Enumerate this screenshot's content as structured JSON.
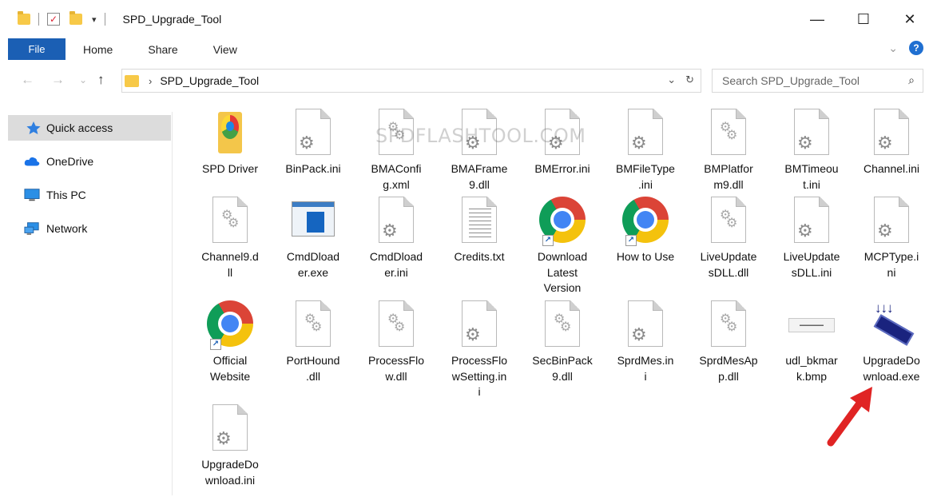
{
  "window": {
    "title": "SPD_Upgrade_Tool",
    "controls": {
      "minimize": "—",
      "maximize": "☐",
      "close": "✕"
    }
  },
  "ribbon": {
    "tabs": [
      "File",
      "Home",
      "Share",
      "View"
    ],
    "expand_glyph": "⌄",
    "help_glyph": "?"
  },
  "address": {
    "back": "←",
    "forward": "→",
    "recent": "⌄",
    "up": "↑",
    "breadcrumb_sep": "›",
    "path": "SPD_Upgrade_Tool",
    "dropdown": "⌄",
    "refresh": "↻",
    "search_placeholder": "Search SPD_Upgrade_Tool",
    "search_glyph": "⌕"
  },
  "sidebar": {
    "items": [
      {
        "label": "Quick access",
        "icon": "star-icon",
        "selected": true
      },
      {
        "label": "OneDrive",
        "icon": "cloud-icon",
        "selected": false
      },
      {
        "label": "This PC",
        "icon": "monitor-icon",
        "selected": false
      },
      {
        "label": "Network",
        "icon": "network-icon",
        "selected": false
      }
    ]
  },
  "watermark": "SPDFLASHTOOL.COM",
  "files": [
    {
      "name": "SPD Driver",
      "label_lines": [
        "SPD Driver"
      ],
      "type": "driver"
    },
    {
      "name": "BinPack.ini",
      "label_lines": [
        "BinPack.ini"
      ],
      "type": "ini"
    },
    {
      "name": "BMAConfig.xml",
      "label_lines": [
        "BMAConfi",
        "g.xml"
      ],
      "type": "dll"
    },
    {
      "name": "BMAFrame9.dll",
      "label_lines": [
        "BMAFrame",
        "9.dll"
      ],
      "type": "ini"
    },
    {
      "name": "BMError.ini",
      "label_lines": [
        "BMError.ini"
      ],
      "type": "ini"
    },
    {
      "name": "BMFileType.ini",
      "label_lines": [
        "BMFileType",
        ".ini"
      ],
      "type": "ini"
    },
    {
      "name": "BMPlatform9.dll",
      "label_lines": [
        "BMPlatfor",
        "m9.dll"
      ],
      "type": "dll"
    },
    {
      "name": "BMTimeout.ini",
      "label_lines": [
        "BMTimeou",
        "t.ini"
      ],
      "type": "ini"
    },
    {
      "name": "Channel.ini",
      "label_lines": [
        "Channel.ini"
      ],
      "type": "ini"
    },
    {
      "name": "Channel9.dll",
      "label_lines": [
        "Channel9.d",
        "ll"
      ],
      "type": "dll"
    },
    {
      "name": "CmdDloader.exe",
      "label_lines": [
        "CmdDload",
        "er.exe"
      ],
      "type": "exe"
    },
    {
      "name": "CmdDloader.ini",
      "label_lines": [
        "CmdDload",
        "er.ini"
      ],
      "type": "ini"
    },
    {
      "name": "Credits.txt",
      "label_lines": [
        "Credits.txt"
      ],
      "type": "txt"
    },
    {
      "name": "Download Latest Version",
      "label_lines": [
        "Download",
        "Latest",
        "Version"
      ],
      "type": "chrome"
    },
    {
      "name": "How to Use",
      "label_lines": [
        "How to Use"
      ],
      "type": "chrome"
    },
    {
      "name": "LiveUpdatesDLL.dll",
      "label_lines": [
        "LiveUpdate",
        "sDLL.dll"
      ],
      "type": "dll"
    },
    {
      "name": "LiveUpdatesDLL.ini",
      "label_lines": [
        "LiveUpdate",
        "sDLL.ini"
      ],
      "type": "ini"
    },
    {
      "name": "MCPType.ini",
      "label_lines": [
        "MCPType.i",
        "ni"
      ],
      "type": "ini"
    },
    {
      "name": "Official Website",
      "label_lines": [
        "Official",
        "Website"
      ],
      "type": "chrome"
    },
    {
      "name": "PortHound.dll",
      "label_lines": [
        "PortHound",
        ".dll"
      ],
      "type": "dll"
    },
    {
      "name": "ProcessFlow.dll",
      "label_lines": [
        "ProcessFlo",
        "w.dll"
      ],
      "type": "dll"
    },
    {
      "name": "ProcessFlowSetting.ini",
      "label_lines": [
        "ProcessFlo",
        "wSetting.in",
        "i"
      ],
      "type": "ini"
    },
    {
      "name": "SecBinPack9.dll",
      "label_lines": [
        "SecBinPack",
        "9.dll"
      ],
      "type": "dll"
    },
    {
      "name": "SprdMes.ini",
      "label_lines": [
        "SprdMes.in",
        "i"
      ],
      "type": "ini"
    },
    {
      "name": "SprdMesApp.dll",
      "label_lines": [
        "SprdMesAp",
        "p.dll"
      ],
      "type": "dll"
    },
    {
      "name": "udl_bkmark.bmp",
      "label_lines": [
        "udl_bkmar",
        "k.bmp"
      ],
      "type": "bmp"
    },
    {
      "name": "UpgradeDownload.exe",
      "label_lines": [
        "UpgradeDo",
        "wnload.exe"
      ],
      "type": "udl"
    },
    {
      "name": "UpgradeDownload.ini",
      "label_lines": [
        "UpgradeDo",
        "wnload.ini"
      ],
      "type": "ini"
    }
  ],
  "colors": {
    "file_tab": "#1b5fb4",
    "selection": "#dcdcdc",
    "annotation_arrow": "#e02424"
  }
}
